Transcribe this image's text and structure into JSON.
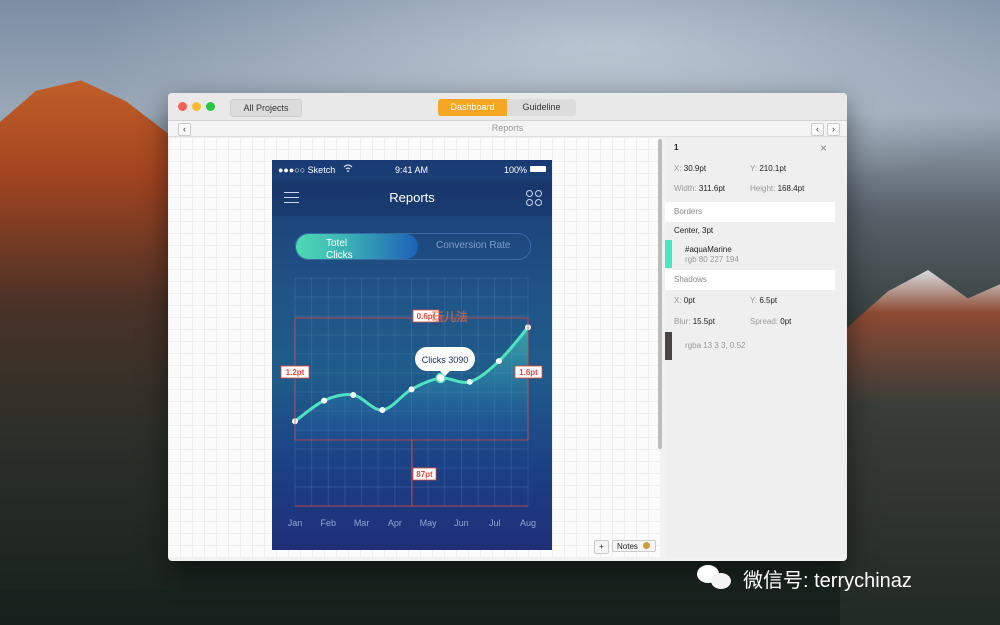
{
  "window": {
    "all_projects": "All Projects",
    "tabs": [
      "Dashboard",
      "Guideline"
    ],
    "subbar_title": "Reports",
    "nav_prev": "‹",
    "nav_next": "›"
  },
  "phone": {
    "status": {
      "carrier": "●●●○○ Sketch",
      "time": "9:41 AM",
      "battery": "100%"
    },
    "title": "Reports",
    "toggle": {
      "active": "Totel Clicks",
      "inactive": "Conversion Rate"
    },
    "tooltip": "Clicks 3090",
    "measurements": {
      "top": "0.6pt",
      "left": "1.2pt",
      "right": "1.6pt",
      "bottom": "87pt"
    },
    "watermark": "玩儿法"
  },
  "chart_data": {
    "type": "line",
    "categories": [
      "Jan",
      "Feb",
      "Mar",
      "Apr",
      "May",
      "Jun",
      "Jul",
      "Aug"
    ],
    "series": [
      {
        "values": [
          1,
          2.1,
          2.4,
          1.6,
          2.7,
          3.3,
          3.1,
          4.2,
          6
        ]
      }
    ],
    "ylim": [
      0,
      6.5
    ],
    "grid": true,
    "highlight_index": 5,
    "line_color": "#50e3c2"
  },
  "inspector": {
    "layer": "1",
    "x": {
      "label": "X:",
      "value": "30.9pt"
    },
    "y": {
      "label": "Y:",
      "value": "210.1pt"
    },
    "width": {
      "label": "Width:",
      "value": "311.6pt"
    },
    "height": {
      "label": "Height:",
      "value": "168.4pt"
    },
    "borders_title": "Borders",
    "border_desc": "Center, 3pt",
    "border_color_name": "#aquaMarine",
    "border_color_rgb": "rgb 80 227 194",
    "border_color": "#50e3c2",
    "shadows_title": "Shadows",
    "shadow_x": {
      "label": "X:",
      "value": "0pt"
    },
    "shadow_y": {
      "label": "Y:",
      "value": "6.5pt"
    },
    "shadow_blur": {
      "label": "Blur:",
      "value": "15.5pt"
    },
    "shadow_spread": {
      "label": "Spread:",
      "value": "0pt"
    },
    "shadow_color": "rgba 13 3 3, 0.52"
  },
  "bottom": {
    "plus": "+",
    "notes": "Notes"
  },
  "watermark_text": "微信号: terrychinaz",
  "colors": {
    "accent": "#f5a623",
    "aqua": "#50e3c2",
    "measure": "#e0493c"
  }
}
